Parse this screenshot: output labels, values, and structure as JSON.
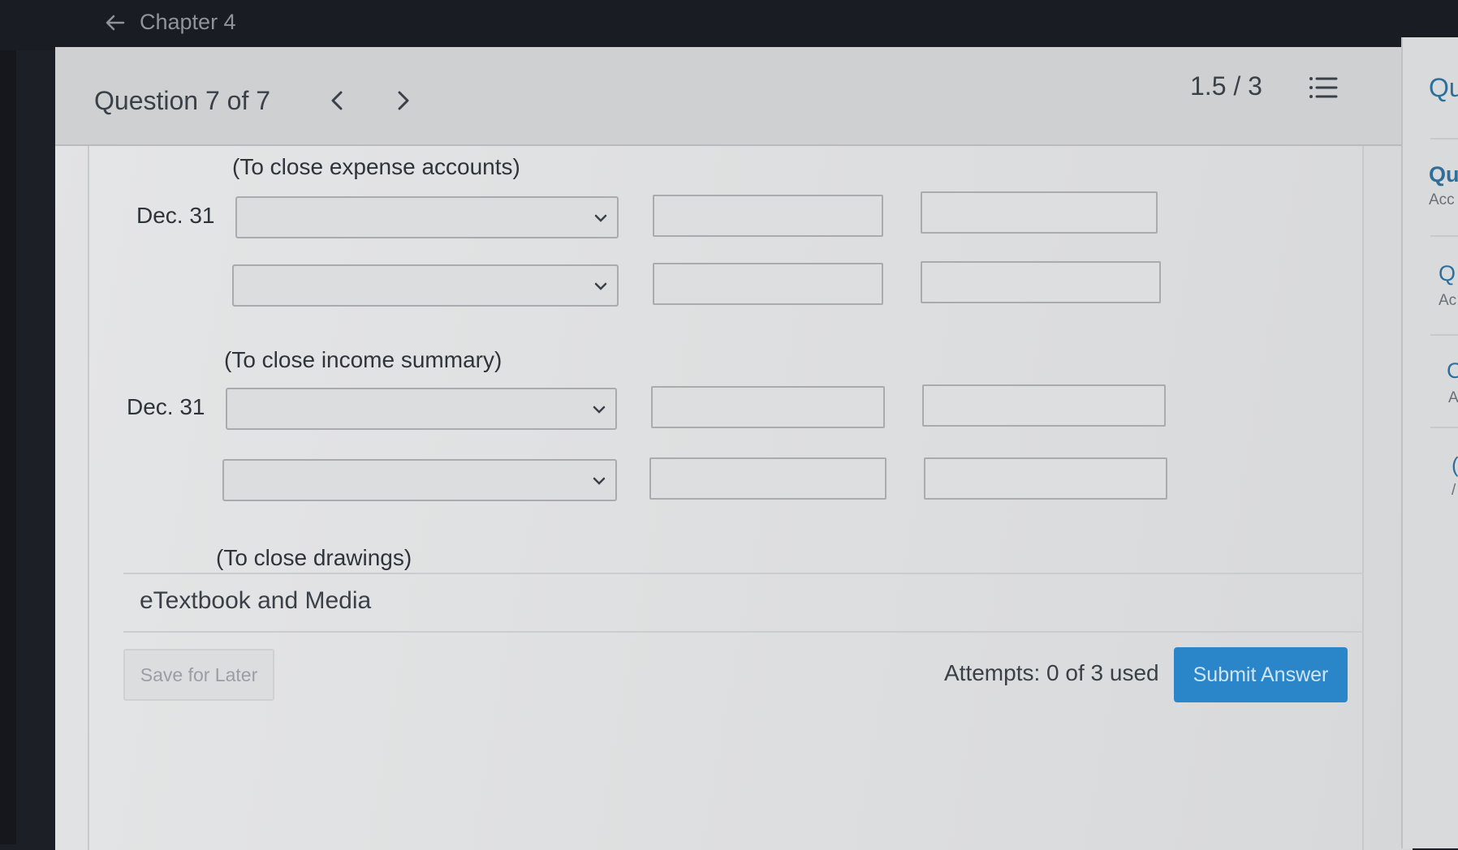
{
  "topbar": {
    "back_label": "Chapter 4"
  },
  "header": {
    "question_title": "Question 7 of 7",
    "score": "1.5 / 3"
  },
  "form": {
    "notes": {
      "expense": "(To close expense accounts)",
      "income": "(To close income summary)",
      "drawings": "(To close drawings)"
    },
    "dates": {
      "entry1": "Dec. 31",
      "entry2": "Dec. 31"
    },
    "rows": [
      {
        "account": "",
        "debit": "",
        "credit": ""
      },
      {
        "account": "",
        "debit": "",
        "credit": ""
      },
      {
        "account": "",
        "debit": "",
        "credit": ""
      },
      {
        "account": "",
        "debit": "",
        "credit": ""
      }
    ]
  },
  "etextbook": {
    "label": "eTextbook and Media"
  },
  "footer": {
    "save_label": "Save for Later",
    "attempts": "Attempts: 0 of 3 used",
    "submit_label": "Submit Answer"
  },
  "right_panel": {
    "items": [
      "Qu",
      "Qu",
      "Acc",
      "Q",
      "Ac",
      "C",
      "A",
      "(",
      "/"
    ]
  },
  "colors": {
    "submit": "#2a86c8",
    "link": "#2d6f9a",
    "text": "#3a4048"
  },
  "icons": {
    "back": "arrow-left-icon",
    "prev": "chevron-left-icon",
    "next": "chevron-right-icon",
    "list": "list-icon",
    "dropdown": "chevron-down-icon"
  }
}
